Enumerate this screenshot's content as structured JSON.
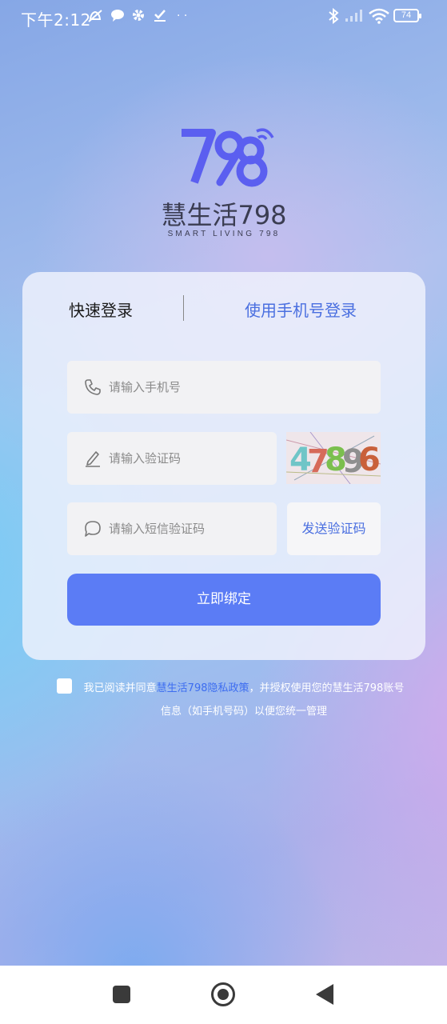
{
  "status_bar": {
    "time": "下午2:12",
    "battery": "74",
    "icons": [
      "mute-bell-icon",
      "chat-bubble-icon",
      "gear-icon",
      "download-check-icon",
      "more-dots-icon",
      "bluetooth-icon",
      "signal-icon",
      "wifi-icon",
      "battery-icon"
    ]
  },
  "logo": {
    "brand": "慧生活798",
    "tagline": "SMART LIVING 798",
    "numerals": "798",
    "color": "#5b5ff0"
  },
  "tabs": {
    "quick": "快速登录",
    "phone": "使用手机号登录"
  },
  "form": {
    "phone_placeholder": "请输入手机号",
    "captcha_placeholder": "请输入验证码",
    "sms_placeholder": "请输入短信验证码",
    "send_code": "发送验证码",
    "captcha_text": "47896",
    "submit": "立即绑定"
  },
  "agreement": {
    "prefix": "我已阅读并同意",
    "link": "慧生活798隐私政策",
    "suffix": "，并授权使用您的慧生活798账号信息（如手机号码）以便您统一管理"
  },
  "colors": {
    "accent": "#5b7cf5",
    "link": "#4a6fe0"
  }
}
